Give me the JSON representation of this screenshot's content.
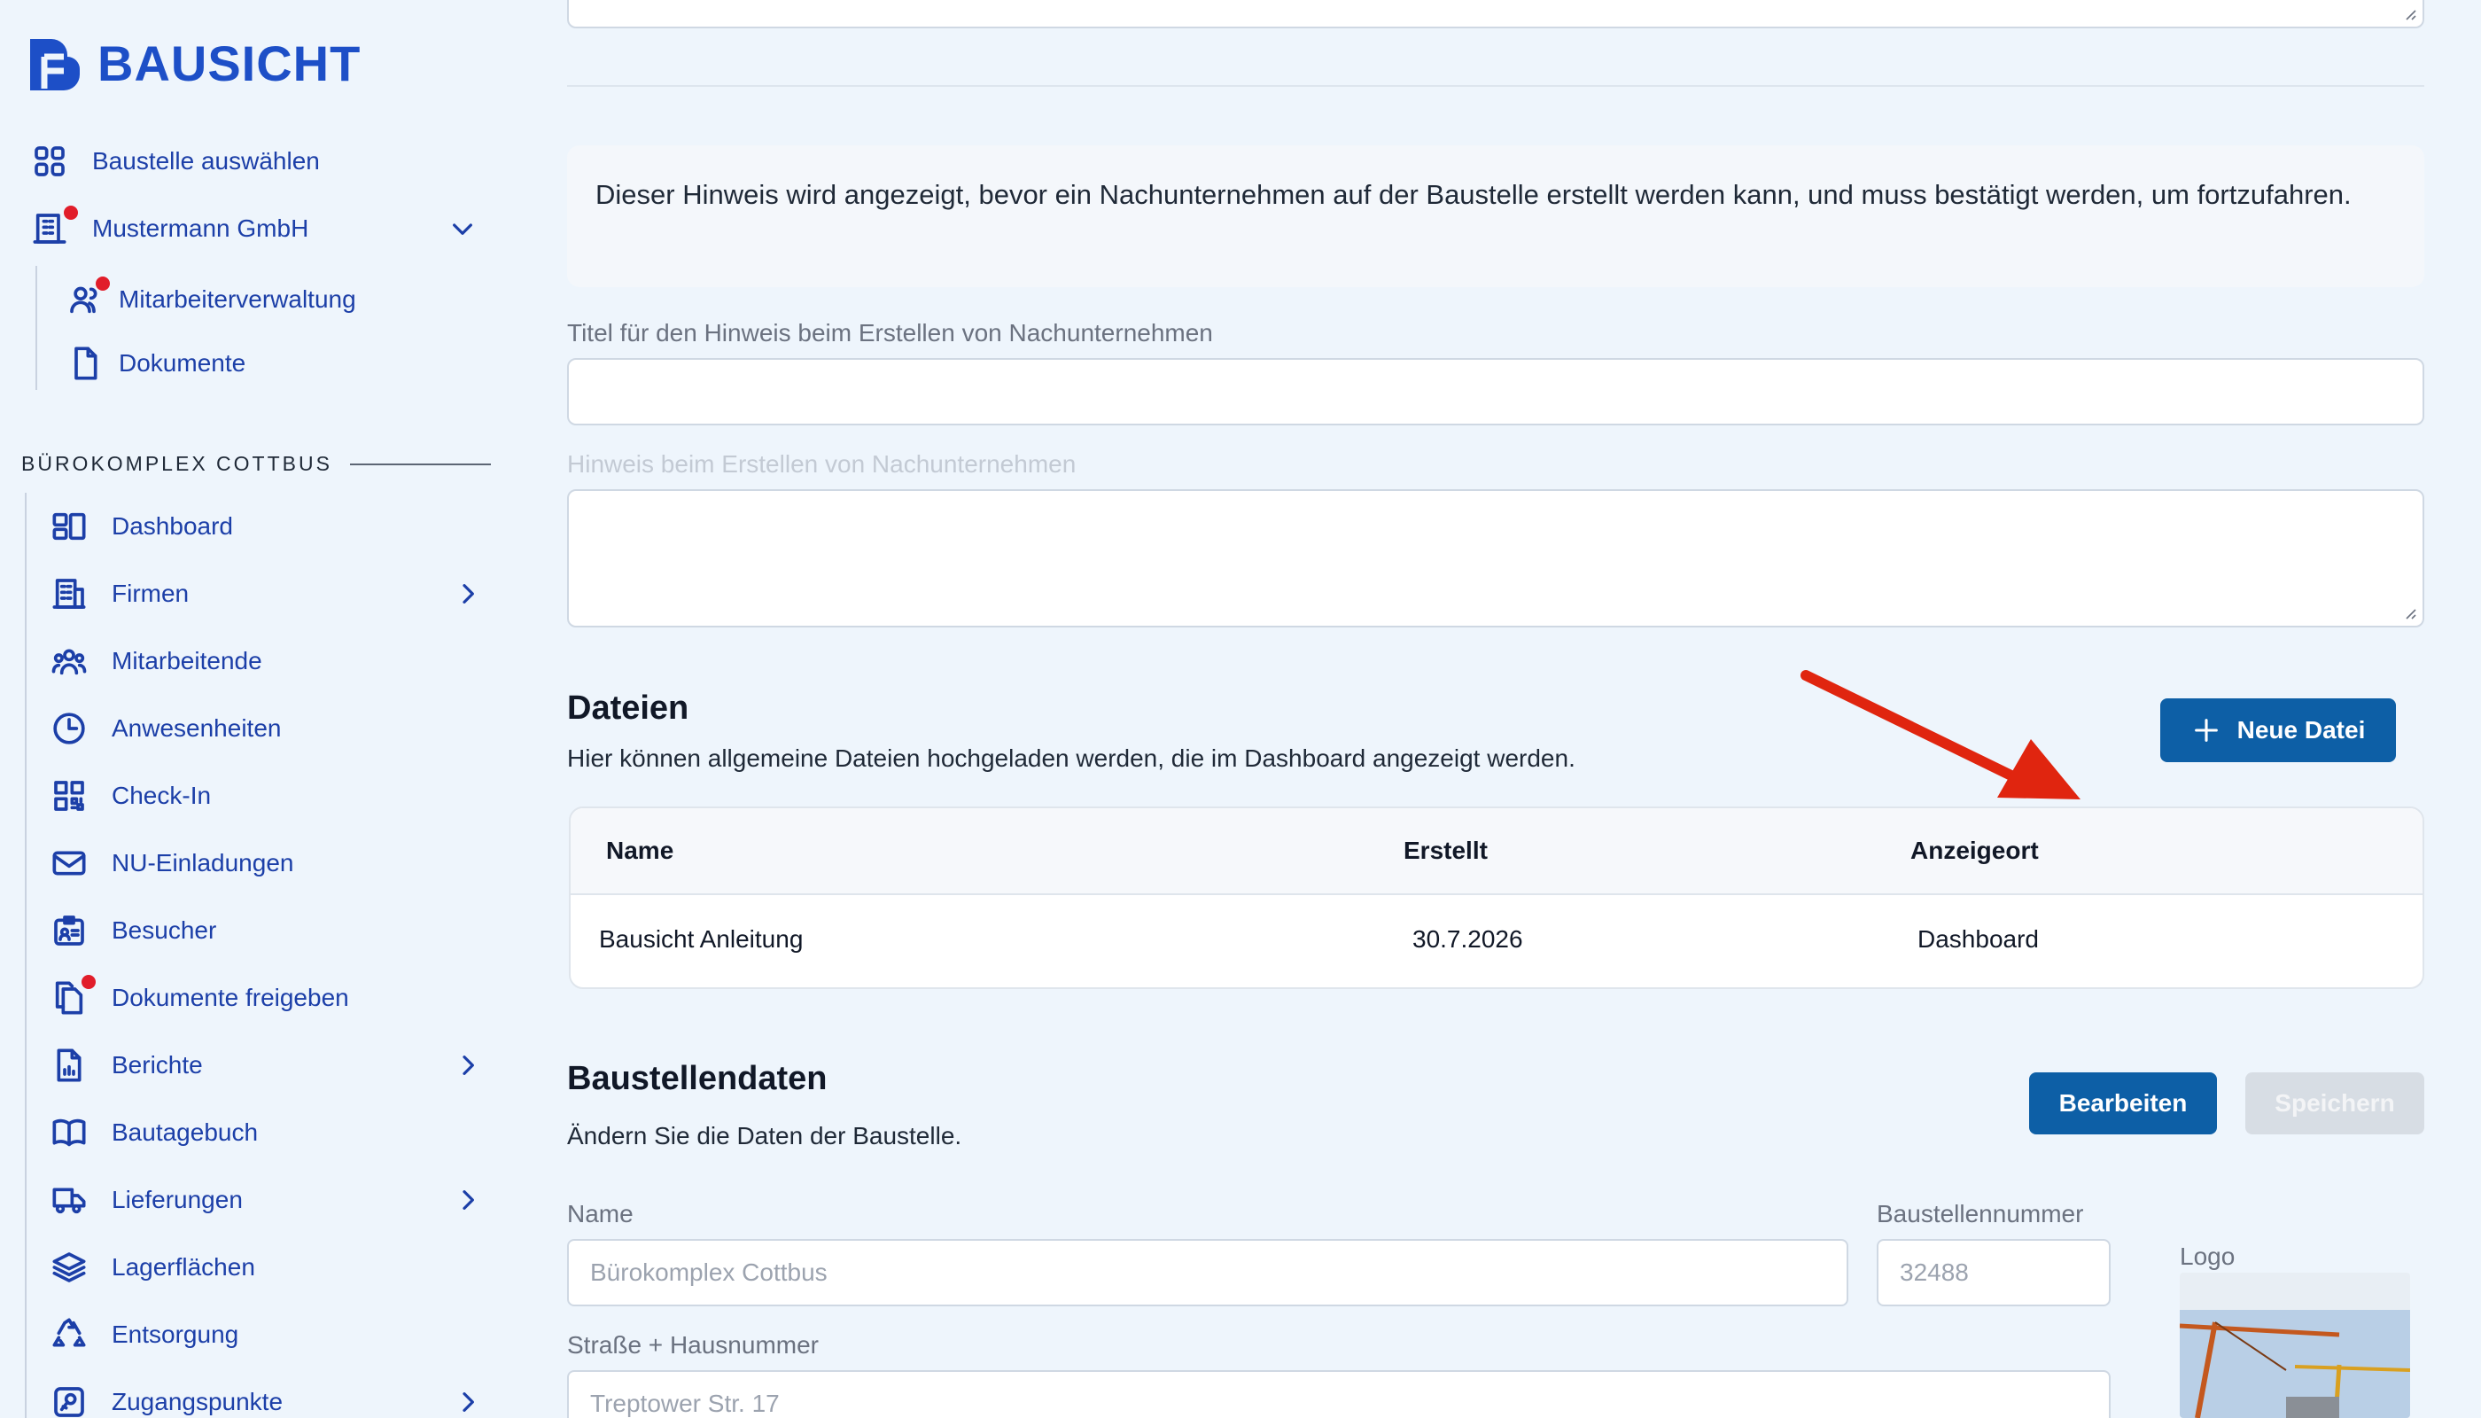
{
  "brand": {
    "name": "BAUSICHT",
    "color": "#1d4fc7"
  },
  "sidebar": {
    "top_items": [
      {
        "label": "Baustelle auswählen",
        "icon": "grid-icon"
      },
      {
        "label": "Mustermann GmbH",
        "icon": "building-icon"
      },
      {
        "label": "Mitarbeiterverwaltung",
        "icon": "users-icon",
        "notification": true
      },
      {
        "label": "Dokumente",
        "icon": "document-icon"
      }
    ],
    "section_title": "BÜROKOMPLEX COTTBUS",
    "items": [
      {
        "label": "Dashboard",
        "icon": "dashboard-icon"
      },
      {
        "label": "Firmen",
        "icon": "building-icon",
        "has_children": true
      },
      {
        "label": "Mitarbeitende",
        "icon": "people-icon"
      },
      {
        "label": "Anwesenheiten",
        "icon": "clock-icon"
      },
      {
        "label": "Check-In",
        "icon": "qrcode-icon"
      },
      {
        "label": "NU-Einladungen",
        "icon": "mail-icon"
      },
      {
        "label": "Besucher",
        "icon": "id-badge-icon"
      },
      {
        "label": "Dokumente freigeben",
        "icon": "documents-icon",
        "notification": true
      },
      {
        "label": "Berichte",
        "icon": "report-icon",
        "has_children": true
      },
      {
        "label": "Bautagebuch",
        "icon": "book-icon"
      },
      {
        "label": "Lieferungen",
        "icon": "truck-icon",
        "has_children": true
      },
      {
        "label": "Lagerflächen",
        "icon": "layers-icon"
      },
      {
        "label": "Entsorgung",
        "icon": "recycle-icon"
      },
      {
        "label": "Zugangspunkte",
        "icon": "access-icon",
        "has_children": true
      }
    ]
  },
  "main": {
    "hint_text": "Dieser Hinweis wird angezeigt, bevor ein Nachunternehmen auf der Baustelle erstellt werden kann, und muss bestätigt werden, um fortzufahren.",
    "title_label": "Titel für den Hinweis beim Erstellen von Nachunternehmen",
    "title_value": "",
    "note_label": "Hinweis beim Erstellen von Nachunternehmen",
    "note_value": "",
    "files": {
      "heading": "Dateien",
      "description": "Hier können allgemeine Dateien hochgeladen werden, die im Dashboard angezeigt werden.",
      "new_button": "Neue Datei",
      "columns": [
        "Name",
        "Erstellt",
        "Anzeigeort"
      ],
      "rows": [
        {
          "name": "Bausicht Anleitung",
          "created": "30.7.2026",
          "location": "Dashboard"
        }
      ]
    },
    "site": {
      "heading": "Baustellendaten",
      "description": "Ändern Sie die Daten der Baustelle.",
      "edit_button": "Bearbeiten",
      "save_button": "Speichern",
      "name_label": "Name",
      "name_value": "Bürokomplex Cottbus",
      "number_label": "Baustellennummer",
      "number_value": "32488",
      "logo_label": "Logo",
      "street_label": "Straße + Hausnummer",
      "street_value": "Treptower Str. 17"
    }
  },
  "colors": {
    "accent": "#0d5fa6",
    "notification": "#e11d2a",
    "annotation_arrow": "#e0250f"
  }
}
